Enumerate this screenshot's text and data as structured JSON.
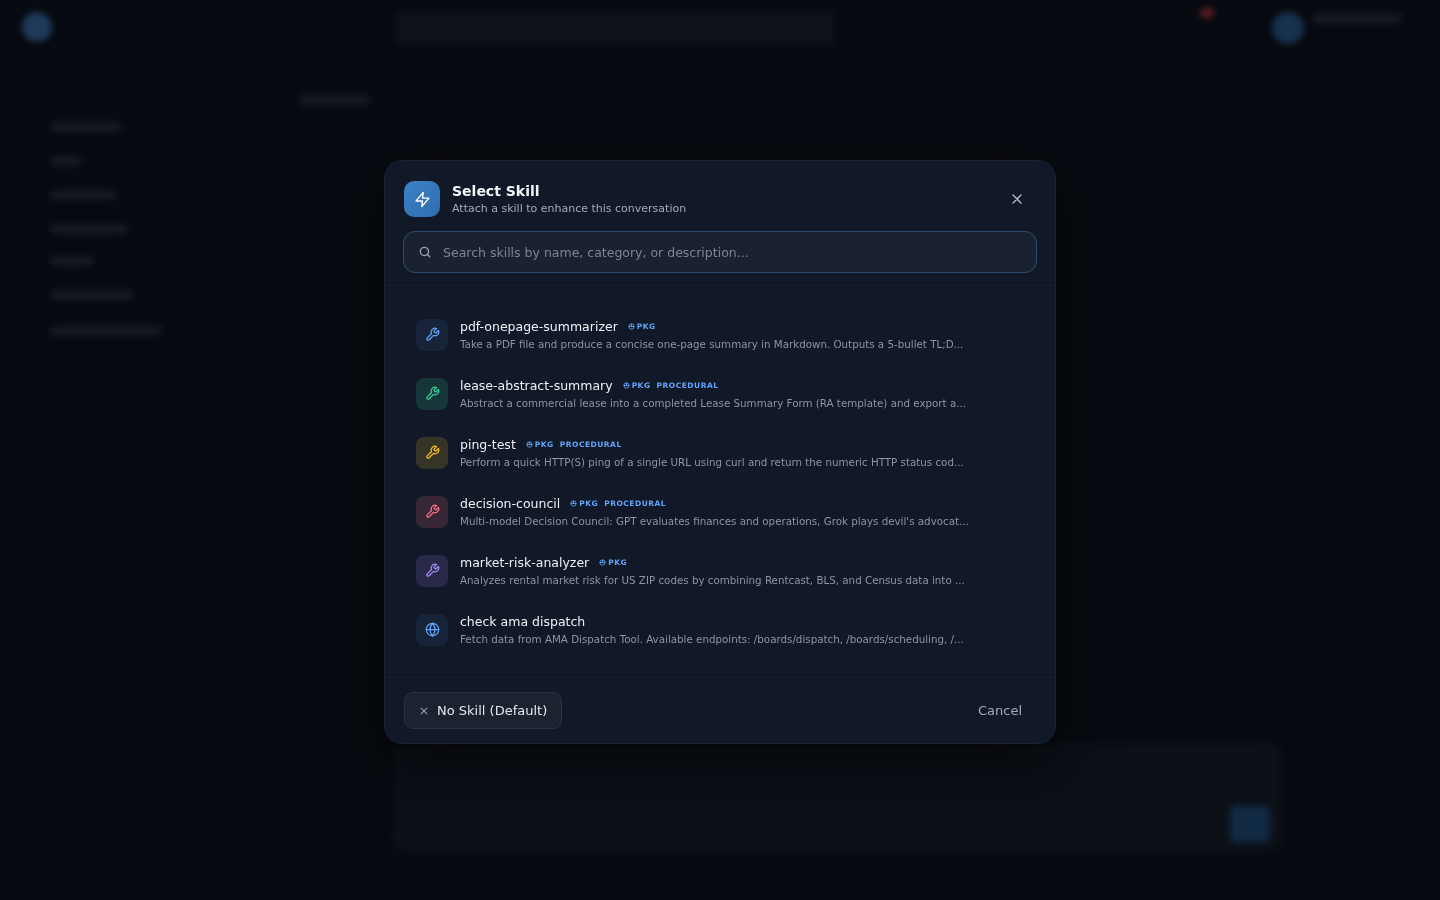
{
  "dialog": {
    "title": "Select Skill",
    "subtitle": "Attach a skill to enhance this conversation",
    "search": {
      "placeholder": "Search skills by name, category, or description..."
    },
    "skills": [
      {
        "name": "pdf-onepage-summarizer",
        "kind": "wrench",
        "color": "#60a5fa",
        "tags": [
          {
            "kind": "pkg",
            "label": "PKG"
          }
        ],
        "description": "Take a PDF file and produce a concise one-page summary in Markdown. Outputs a 5-bullet TL;D..."
      },
      {
        "name": "lease-abstract-summary",
        "kind": "wrench",
        "color": "#34d399",
        "tags": [
          {
            "kind": "pkg",
            "label": "PKG"
          },
          {
            "kind": "category",
            "label": "PROCEDURAL"
          }
        ],
        "description": "Abstract a commercial lease into a completed Lease Summary Form (RA template) and export a..."
      },
      {
        "name": "ping-test",
        "kind": "wrench",
        "color": "#fbbf24",
        "tags": [
          {
            "kind": "pkg",
            "label": "PKG"
          },
          {
            "kind": "category",
            "label": "PROCEDURAL"
          }
        ],
        "description": "Perform a quick HTTP(S) ping of a single URL using curl and return the numeric HTTP status cod..."
      },
      {
        "name": "decision-council",
        "kind": "wrench",
        "color": "#fb7185",
        "tags": [
          {
            "kind": "pkg",
            "label": "PKG"
          },
          {
            "kind": "category",
            "label": "PROCEDURAL"
          }
        ],
        "description": "Multi-model Decision Council: GPT evaluates finances and operations, Grok plays devil's advocat..."
      },
      {
        "name": "market-risk-analyzer",
        "kind": "wrench",
        "color": "#a78bfa",
        "tags": [
          {
            "kind": "pkg",
            "label": "PKG"
          }
        ],
        "description": "Analyzes rental market risk for US ZIP codes by combining Rentcast, BLS, and Census data into ..."
      },
      {
        "name": "check ama dispatch",
        "kind": "globe",
        "color": "#60a5fa",
        "description": "Fetch data from AMA Dispatch Tool. Available endpoints: /boards/dispatch, /boards/scheduling, /..."
      }
    ],
    "buttons": [
      {
        "kind": "clear",
        "label": "No Skill (Default)"
      },
      {
        "kind": "cancel",
        "label": "Cancel"
      }
    ]
  }
}
